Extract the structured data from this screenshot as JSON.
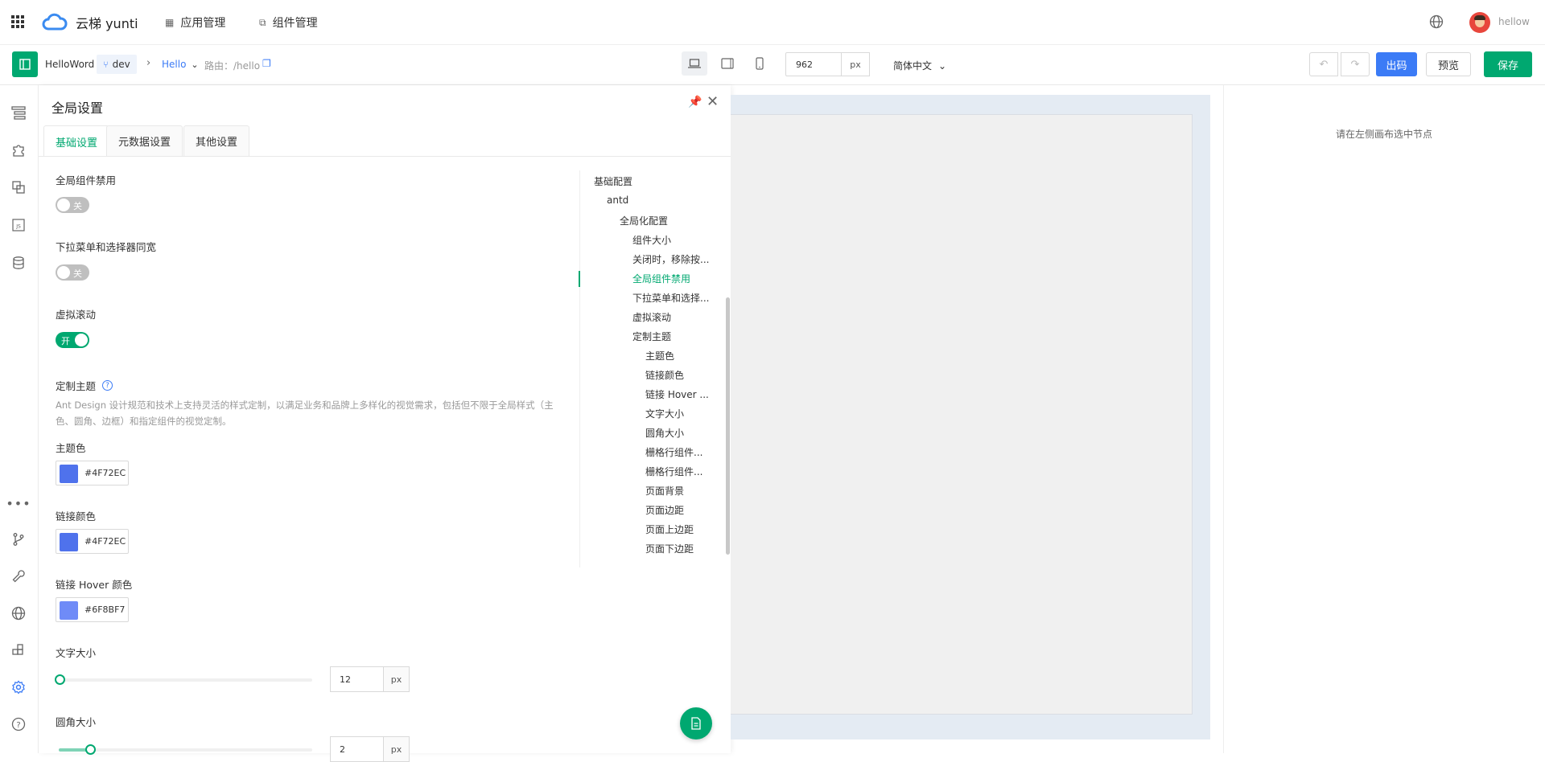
{
  "topbar": {
    "logo_text": "云梯 yunti",
    "nav": [
      {
        "label": "应用管理",
        "icon": "grid-icon"
      },
      {
        "label": "组件管理",
        "icon": "components-icon"
      }
    ],
    "user_name": "hellow"
  },
  "toolbar": {
    "app_name": "HelloWord",
    "branch": "dev",
    "page": "Hello",
    "route_label": "路由：/hello",
    "width_value": "962",
    "width_unit": "px",
    "language": "简体中文",
    "export_label": "出码",
    "preview_label": "预览",
    "save_label": "保存"
  },
  "panel": {
    "title": "全局设置",
    "tabs": [
      "基础设置",
      "元数据设置",
      "其他设置"
    ],
    "fields": {
      "disable_label": "全局组件禁用",
      "disable_state": "关",
      "dropdown_label": "下拉菜单和选择器同宽",
      "dropdown_state": "关",
      "virtual_label": "虚拟滚动",
      "virtual_state": "开",
      "theme_label": "定制主题",
      "theme_desc": "Ant Design 设计规范和技术上支持灵活的样式定制，以满足业务和品牌上多样化的视觉需求，包括但不限于全局样式（主色、圆角、边框）和指定组件的视觉定制。",
      "primary_label": "主题色",
      "primary_value": "#4F72EC",
      "link_label": "链接颜色",
      "link_value": "#4F72EC",
      "hover_label": "链接 Hover 颜色",
      "hover_value": "#6F8BF7",
      "font_label": "文字大小",
      "font_value": "12",
      "font_unit": "px",
      "radius_label": "圆角大小",
      "radius_value": "2",
      "radius_unit": "px"
    },
    "tree": {
      "root": "基础配置",
      "l1": "antd",
      "l2": "全局化配置",
      "items": [
        "组件大小",
        "关闭时，移除按...",
        "全局组件禁用",
        "下拉菜单和选择...",
        "虚拟滚动",
        "定制主题"
      ],
      "sub": [
        "主题色",
        "链接颜色",
        "链接 Hover ...",
        "文字大小",
        "圆角大小",
        "栅格行组件...",
        "栅格行组件...",
        "页面背景",
        "页面边距",
        "页面上边距",
        "页面下边距"
      ]
    }
  },
  "right_panel": {
    "hint": "请在左侧画布选中节点"
  },
  "colors": {
    "accent": "#00a870",
    "primary_blue": "#4F72EC",
    "hover_blue": "#6F8BF7",
    "export_btn": "#3b7bf6"
  }
}
